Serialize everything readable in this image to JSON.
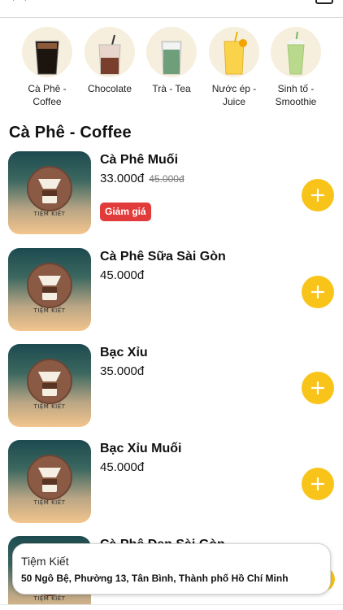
{
  "categories": [
    {
      "label": "Cà Phê - Coffee",
      "icon": "coffee-glass-icon"
    },
    {
      "label": "Chocolate",
      "icon": "chocolate-drink-icon"
    },
    {
      "label": "Trà - Tea",
      "icon": "tea-glass-icon"
    },
    {
      "label": "Nước ép - Juice",
      "icon": "juice-glass-icon"
    },
    {
      "label": "Sinh tố - Smoothie",
      "icon": "smoothie-glass-icon"
    }
  ],
  "section_title": "Cà Phê - Coffee",
  "brand_text": "TIỆM KIẾT",
  "items": [
    {
      "name": "Cà Phê Muối",
      "price": "33.000đ",
      "old_price": "45.000đ",
      "badge": "Giảm giá"
    },
    {
      "name": "Cà Phê Sữa Sài Gòn",
      "price": "45.000đ"
    },
    {
      "name": "Bạc Xỉu",
      "price": "35.000đ"
    },
    {
      "name": "Bạc Xỉu Muối",
      "price": "45.000đ"
    },
    {
      "name": "Cà Phê Đen Sài Gòn",
      "price": ""
    }
  ],
  "store": {
    "name": "Tiệm Kiết",
    "address": "50 Ngô Bệ, Phường 13, Tân Bình, Thành phố Hồ Chí Minh"
  },
  "colors": {
    "accent": "#f8c41a",
    "badge": "#e23b3b",
    "category_bg": "#f7efdd"
  }
}
